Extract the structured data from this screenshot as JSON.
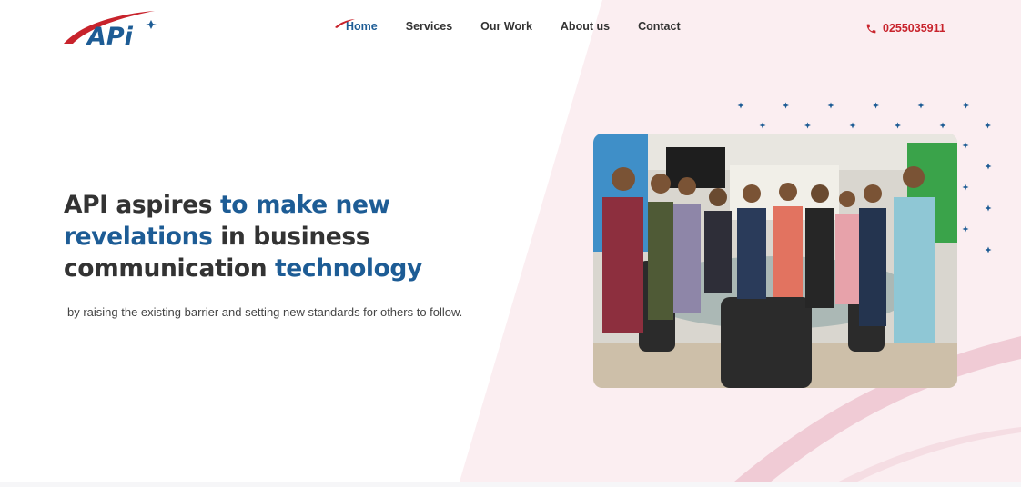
{
  "brand": {
    "logo_text": "APi"
  },
  "nav": {
    "items": [
      {
        "label": "Home"
      },
      {
        "label": "Services"
      },
      {
        "label": "Our Work"
      },
      {
        "label": "About us"
      },
      {
        "label": "Contact"
      }
    ],
    "active": "Home"
  },
  "contact": {
    "phone": "0255035911",
    "icon": "phone-icon"
  },
  "hero": {
    "title_part1": "API aspires ",
    "title_part2": "to make new",
    "title_part3": "revelations",
    "title_part4": " in business",
    "title_part5": "communication ",
    "title_part6": "technology",
    "subtitle": "by raising the existing barrier and setting new standards for others to follow."
  },
  "colors": {
    "accent_blue": "#1d5c95",
    "brand_red": "#c8232c",
    "bg_pink": "#f9eaee",
    "arc_pink": "#ecc5cf"
  }
}
